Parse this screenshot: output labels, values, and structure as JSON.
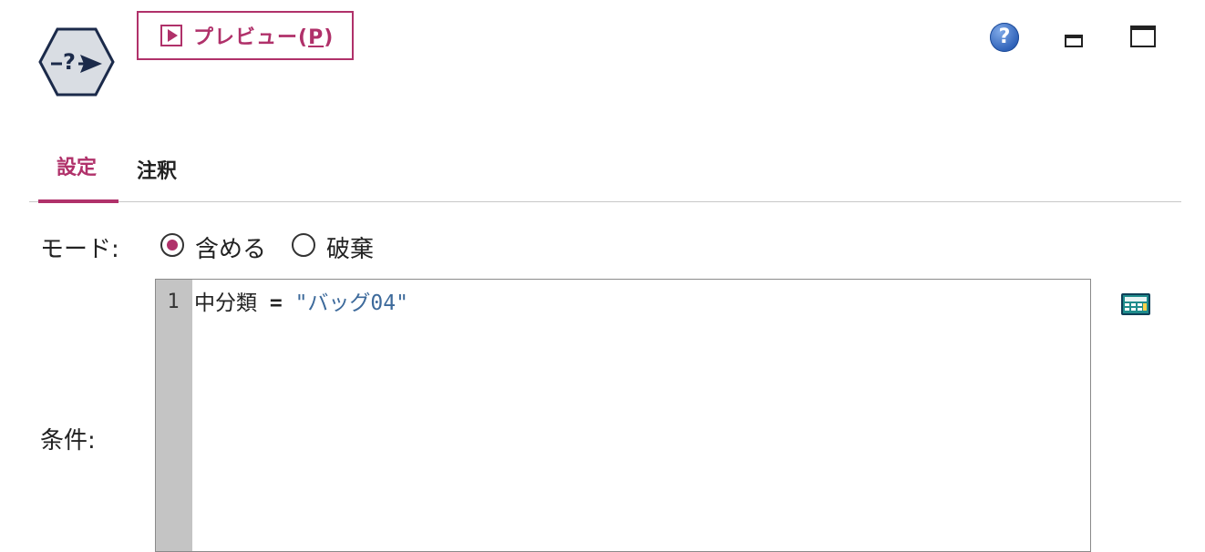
{
  "toolbar": {
    "preview_label": "プレビュー(",
    "preview_mnemonic": "P",
    "preview_suffix": ")",
    "help_glyph": "?"
  },
  "tabs": [
    {
      "label": "設定",
      "active": true
    },
    {
      "label": "注釈",
      "active": false
    }
  ],
  "mode": {
    "label": "モード:",
    "options": [
      {
        "label": "含める",
        "selected": true
      },
      {
        "label": "破棄",
        "selected": false
      }
    ]
  },
  "condition": {
    "label": "条件:",
    "line_number": "1",
    "code": {
      "field": "中分類 ",
      "operator": "=",
      "value": " \"バッグ04\""
    }
  },
  "icons": {
    "node": "select-node-icon",
    "preview": "play-icon",
    "help": "help-icon",
    "minimize": "minimize-icon",
    "maximize": "maximize-icon",
    "expression_builder": "expression-builder-icon"
  },
  "colors": {
    "accent": "#b0316a",
    "string_literal": "#3d6a9b",
    "gutter": "#c4c4c4"
  }
}
